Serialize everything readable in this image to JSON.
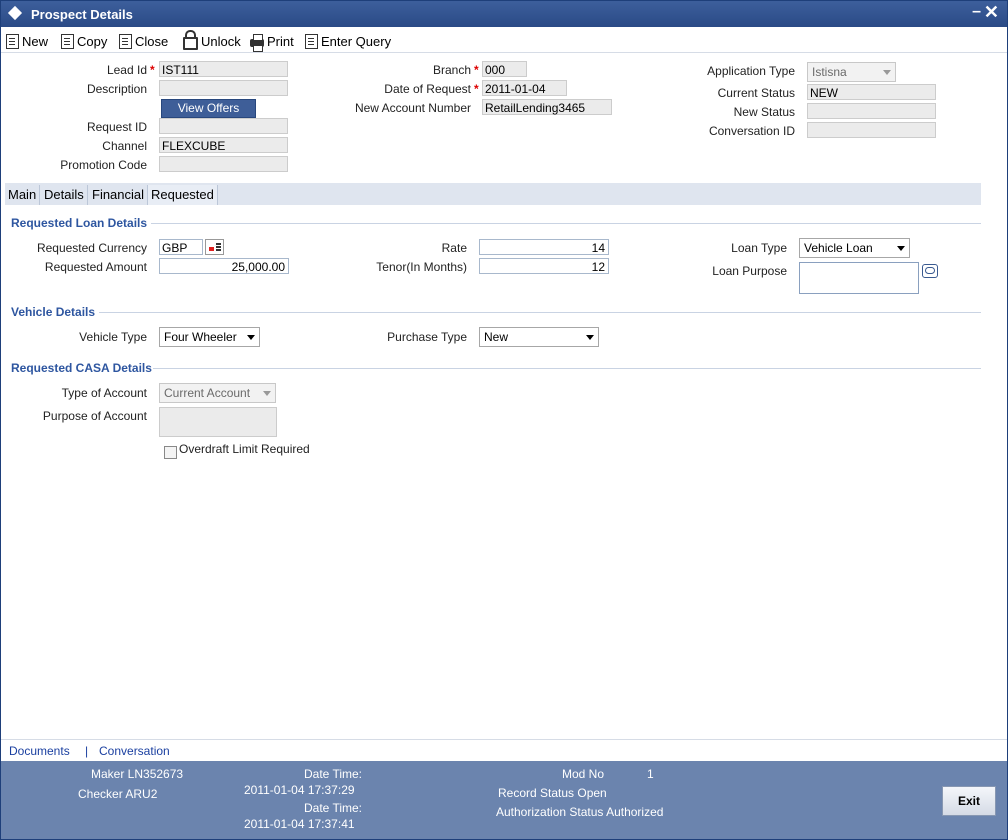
{
  "window": {
    "title": "Prospect Details"
  },
  "toolbar": {
    "new": "New",
    "copy": "Copy",
    "close": "Close",
    "unlock": "Unlock",
    "print": "Print",
    "enter_query": "Enter Query"
  },
  "header": {
    "lead_id_label": "Lead Id",
    "lead_id": "IST111",
    "description_label": "Description",
    "description": "",
    "view_offers": "View Offers",
    "request_id_label": "Request ID",
    "request_id": "",
    "channel_label": "Channel",
    "channel": "FLEXCUBE",
    "promotion_code_label": "Promotion Code",
    "promotion_code": "",
    "branch_label": "Branch",
    "branch": "000",
    "date_of_request_label": "Date of Request",
    "date_of_request": "2011-01-04",
    "new_account_number_label": "New Account Number",
    "new_account_number": "RetailLending3465",
    "application_type_label": "Application Type",
    "application_type": "Istisna",
    "current_status_label": "Current Status",
    "current_status": "NEW",
    "new_status_label": "New Status",
    "new_status": "",
    "conversation_id_label": "Conversation ID",
    "conversation_id": "",
    "required_mark": "*"
  },
  "tabs": [
    "Main",
    "Details",
    "Financial",
    "Requested"
  ],
  "loan": {
    "section": "Requested Loan Details",
    "currency_label": "Requested Currency",
    "currency": "GBP",
    "amount_label": "Requested Amount",
    "amount": "25,000.00",
    "rate_label": "Rate",
    "rate": "14",
    "tenor_label": "Tenor(In Months)",
    "tenor": "12",
    "loan_type_label": "Loan Type",
    "loan_type": "Vehicle Loan",
    "loan_purpose_label": "Loan Purpose"
  },
  "vehicle": {
    "section": "Vehicle Details",
    "type_label": "Vehicle Type",
    "type": "Four Wheeler",
    "purchase_label": "Purchase Type",
    "purchase": "New"
  },
  "casa": {
    "section": "Requested CASA Details",
    "type_label": "Type of Account",
    "type": "Current Account",
    "purpose_label": "Purpose of Account",
    "overdraft_label": "Overdraft Limit Required"
  },
  "footer": {
    "documents": "Documents",
    "separator": "|",
    "conversation": "Conversation",
    "maker": "Maker LN352673",
    "checker": "Checker ARU2",
    "date_time_label": "Date Time:",
    "maker_time": "2011-01-04 17:37:29",
    "checker_time": "2011-01-04 17:37:41",
    "mod_no_label": "Mod No",
    "mod_no": "1",
    "record_status": "Record Status Open",
    "auth_status": "Authorization Status Authorized",
    "exit": "Exit"
  },
  "colors": {
    "title_bar": "#2a4a86",
    "section_heading": "#2e56a0",
    "status_bar": "#6b84ae"
  }
}
